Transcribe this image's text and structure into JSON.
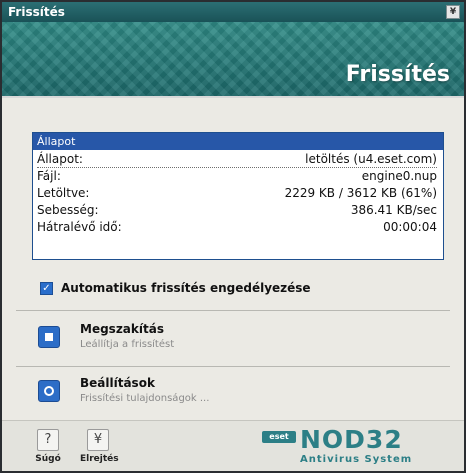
{
  "window": {
    "title": "Frissítés",
    "collapse_glyph": "¥"
  },
  "banner": {
    "title": "Frissítés"
  },
  "status": {
    "header": "Állapot",
    "rows": [
      {
        "label": "Állapot:",
        "value": "letöltés (u4.eset.com)"
      },
      {
        "label": "Fájl:",
        "value": "engine0.nup"
      },
      {
        "label": "Letöltve:",
        "value": "2229 KB / 3612 KB (61%)"
      },
      {
        "label": "Sebesség:",
        "value": "386.41 KB/sec"
      },
      {
        "label": "Hátralévő idő:",
        "value": "00:00:04"
      }
    ]
  },
  "auto_update": {
    "label": "Automatikus frissítés engedélyezése",
    "checked": true
  },
  "actions": {
    "stop": {
      "title": "Megszakítás",
      "subtitle": "Leállítja a frissítést",
      "icon": "stop-icon"
    },
    "settings": {
      "title": "Beállítások",
      "subtitle": "Frissítési tulajdonságok ...",
      "icon": "gear-icon"
    }
  },
  "footer": {
    "help_label": "Súgó",
    "help_icon": "?",
    "hide_label": "Elrejtés",
    "hide_icon": "¥"
  },
  "brand": {
    "badge": "eset",
    "product": "NOD32",
    "tagline": "Antivirus System"
  },
  "colors": {
    "accent": "#2757a8",
    "teal": "#2c7f86"
  }
}
